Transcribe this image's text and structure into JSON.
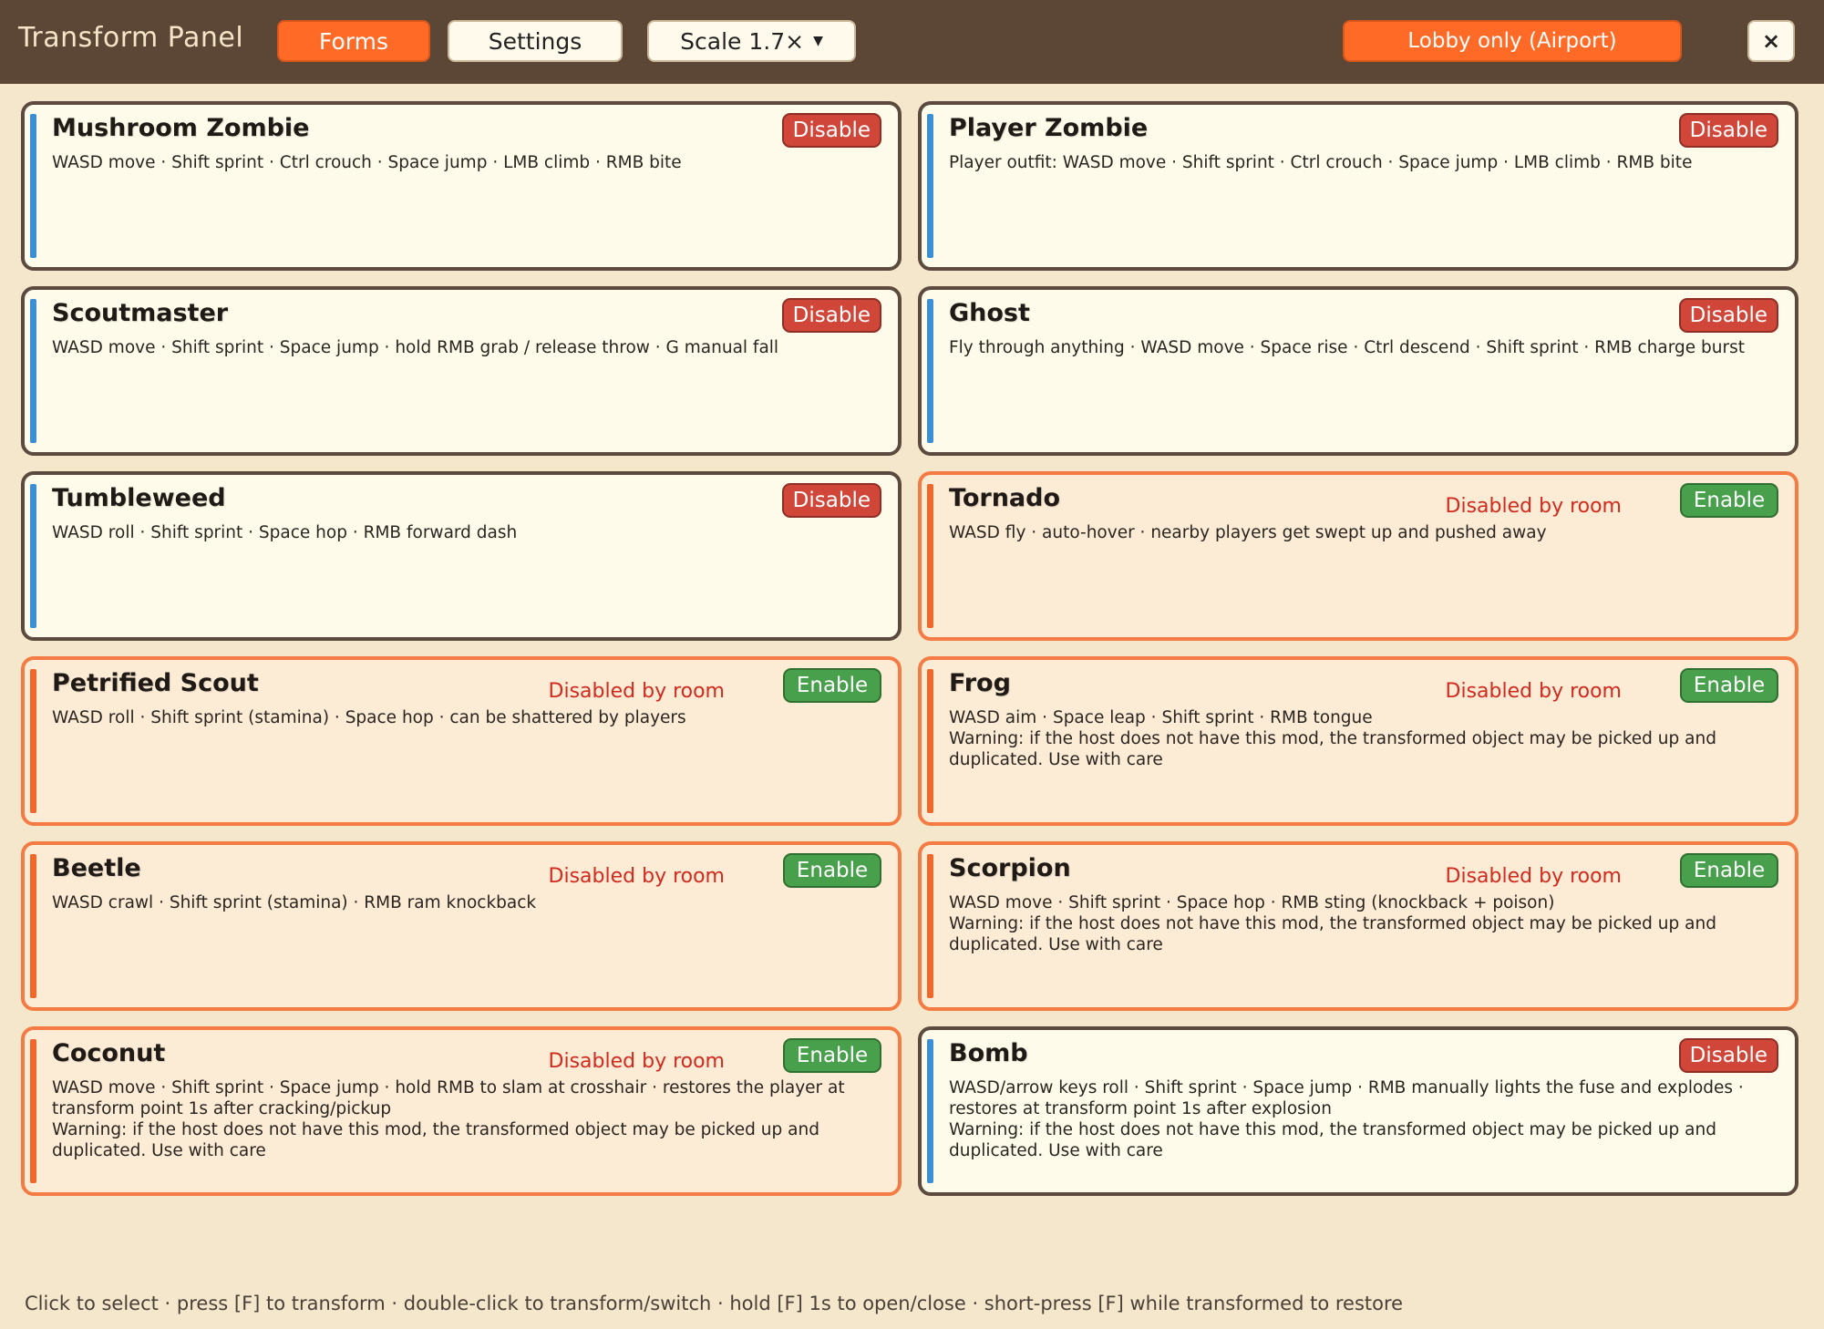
{
  "header": {
    "title": "Transform Panel",
    "tabs": [
      {
        "label": "Forms",
        "active": true
      },
      {
        "label": "Settings",
        "active": false
      }
    ],
    "scale_label": "Scale 1.7×",
    "lobby_label": "Lobby only (Airport)",
    "close_label": "×"
  },
  "colors": {
    "header_bg": "#5c4636",
    "accent": "#ff6a26",
    "enabled_stripe": "#3a8fd6",
    "disabled_border": "#f47b43",
    "disable_button": "#d0473a",
    "enable_button": "#49a04c",
    "status_text": "#d12a1e"
  },
  "forms": [
    {
      "name": "Mushroom Zombie",
      "desc": "WASD move · Shift sprint · Ctrl crouch · Space jump · LMB climb · RMB bite",
      "state": "enabled",
      "button": "Disable",
      "status": ""
    },
    {
      "name": "Player Zombie",
      "desc": "Player outfit: WASD move · Shift sprint · Ctrl crouch · Space jump · LMB climb · RMB bite",
      "state": "enabled",
      "button": "Disable",
      "status": ""
    },
    {
      "name": "Scoutmaster",
      "desc": "WASD move · Shift sprint · Space jump · hold RMB grab / release throw · G manual fall",
      "state": "enabled",
      "button": "Disable",
      "status": ""
    },
    {
      "name": "Ghost",
      "desc": "Fly through anything · WASD move · Space rise · Ctrl descend · Shift sprint · RMB charge burst",
      "state": "enabled",
      "button": "Disable",
      "status": ""
    },
    {
      "name": "Tumbleweed",
      "desc": "WASD roll · Shift sprint · Space hop · RMB forward dash",
      "state": "enabled",
      "button": "Disable",
      "status": ""
    },
    {
      "name": "Tornado",
      "desc": "WASD fly · auto-hover · nearby players get swept up and pushed away",
      "state": "disabled",
      "button": "Enable",
      "status": "Disabled by room"
    },
    {
      "name": "Petrified Scout",
      "desc": "WASD roll · Shift sprint (stamina) · Space hop · can be shattered by players",
      "state": "disabled",
      "button": "Enable",
      "status": "Disabled by room"
    },
    {
      "name": "Frog",
      "desc": "WASD aim · Space leap · Shift sprint · RMB tongue\nWarning: if the host does not have this mod, the transformed object may be picked up and duplicated. Use with care",
      "state": "disabled",
      "button": "Enable",
      "status": "Disabled by room"
    },
    {
      "name": "Beetle",
      "desc": "WASD crawl · Shift sprint (stamina) · RMB ram knockback",
      "state": "disabled",
      "button": "Enable",
      "status": "Disabled by room"
    },
    {
      "name": "Scorpion",
      "desc": "WASD move · Shift sprint · Space hop · RMB sting (knockback + poison)\nWarning: if the host does not have this mod, the transformed object may be picked up and duplicated. Use with care",
      "state": "disabled",
      "button": "Enable",
      "status": "Disabled by room"
    },
    {
      "name": "Coconut",
      "desc": "WASD move · Shift sprint · Space jump · hold RMB to slam at crosshair · restores the player at transform point 1s after cracking/pickup\nWarning: if the host does not have this mod, the transformed object may be picked up and duplicated. Use with care",
      "state": "disabled",
      "button": "Enable",
      "status": "Disabled by room"
    },
    {
      "name": "Bomb",
      "desc": "WASD/arrow keys roll · Shift sprint · Space jump · RMB manually lights the fuse and explodes · restores at transform point 1s after explosion\nWarning: if the host does not have this mod, the transformed object may be picked up and duplicated. Use with care",
      "state": "enabled",
      "button": "Disable",
      "status": ""
    }
  ],
  "footer": {
    "hint": "Click to select · press [F] to transform · double-click to transform/switch · hold [F] 1s to open/close · short-press [F] while transformed to restore"
  }
}
